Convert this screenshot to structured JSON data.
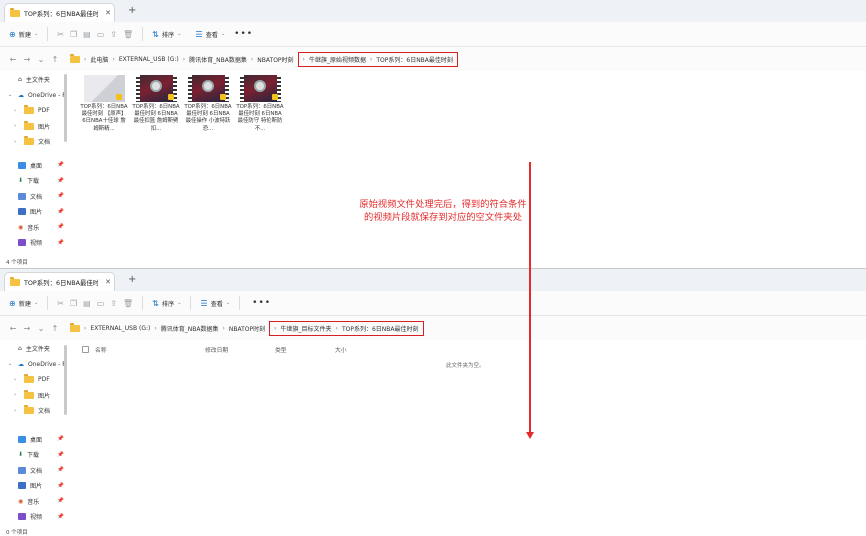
{
  "window1": {
    "tab_title": "TOP系列：6日NBA最佳时刻",
    "toolbar": {
      "new_label": "新建",
      "sort_label": "排序",
      "view_label": "查看"
    },
    "breadcrumbs_plain": [
      "此电脑",
      "EXTERNAL_USB (G:)",
      "腾讯体育_NBA数据集",
      "NBATOP时刻"
    ],
    "breadcrumbs_boxed": [
      "牛继旗_原始视频数据",
      "TOP系列：6日NBA最佳时刻"
    ],
    "sidebar": {
      "home": "主文件夹",
      "onedrive": "OneDrive - P",
      "folders": [
        "PDF",
        "图片",
        "文档"
      ],
      "quick": [
        "桌面",
        "下载",
        "文档",
        "图片",
        "音乐",
        "视频"
      ]
    },
    "files": [
      "TOP系列：6日NBA最佳时刻 【原声】6日NBA十佳球 詹姆斯精...",
      "TOP系列：6日NBA最佳时刻 6日NBA最佳扣篮 詹姆斯劈扣...",
      "TOP系列：6日NBA最佳时刻 6日NBA最佳操作 小波特跃恐...",
      "TOP系列：6日NBA最佳时刻 6日NBA最佳防守 特伦斯防不..."
    ],
    "status": "4 个项目"
  },
  "window2": {
    "tab_title": "TOP系列：6日NBA最佳时刻",
    "toolbar": {
      "new_label": "新建",
      "sort_label": "排序",
      "view_label": "查看"
    },
    "breadcrumbs_plain": [
      "EXTERNAL_USB (G:)",
      "腾讯体育_NBA数据集",
      "NBATOP时刻"
    ],
    "breadcrumbs_boxed": [
      "牛继旗_目标文件夹",
      "TOP系列：6日NBA最佳时刻"
    ],
    "columns": [
      "名称",
      "修改日期",
      "类型",
      "大小"
    ],
    "empty_message": "此文件夹为空。",
    "sidebar": {
      "home": "主文件夹",
      "onedrive": "OneDrive - P",
      "folders": [
        "PDF",
        "图片",
        "文档"
      ],
      "quick": [
        "桌面",
        "下载",
        "文档",
        "图片",
        "音乐",
        "视频"
      ]
    },
    "status": "0 个项目"
  },
  "annotation": {
    "line1": "原始视频文件处理完后，得到的符合条件",
    "line2": "的视频片段就保存到对应的空文件夹处"
  },
  "colors": {
    "accent": "#1a73c7",
    "highlight_red": "#e32b2b",
    "folder": "#f5c242"
  }
}
